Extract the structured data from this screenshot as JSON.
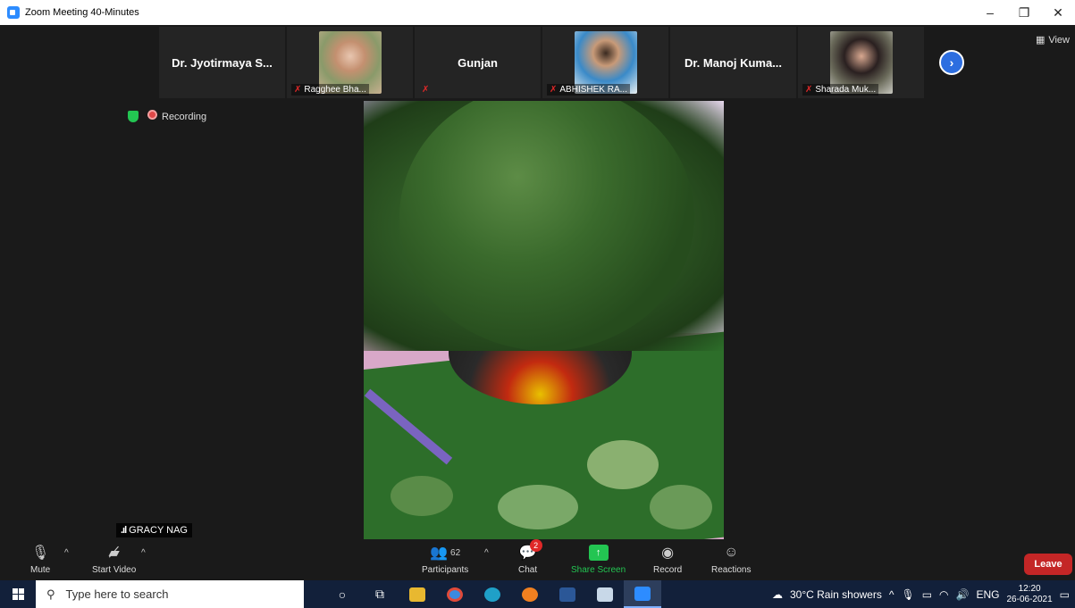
{
  "window": {
    "title": "Zoom Meeting 40-Minutes",
    "controls": [
      "–",
      "❐",
      "✕"
    ]
  },
  "thumbnails": [
    {
      "name": "Dr. Jyotirmaya S...",
      "has_video": false
    },
    {
      "name": "Ragghee Bha...",
      "has_video": true,
      "muted": true
    },
    {
      "name": "Gunjan",
      "has_video": false,
      "muted": true
    },
    {
      "name": "ABHISHEK RA...",
      "has_video": true,
      "muted": true
    },
    {
      "name": "Dr. Manoj Kuma...",
      "has_video": false
    },
    {
      "name": "Sharada Muk...",
      "has_video": true,
      "muted": true
    }
  ],
  "view_label": "View",
  "recording_label": "Recording",
  "main_video": {
    "name": "GRACY NAG"
  },
  "toolbar": {
    "mute": "Mute",
    "start_video": "Start Video",
    "participants": "Participants",
    "participants_count": "62",
    "chat": "Chat",
    "chat_badge": "2",
    "share_screen": "Share Screen",
    "record": "Record",
    "reactions": "Reactions",
    "leave": "Leave"
  },
  "taskbar": {
    "search_placeholder": "Type here to search",
    "weather": "30°C  Rain showers",
    "language": "ENG",
    "time": "12:20",
    "date": "26-06-2021"
  },
  "colors": {
    "accent": "#2d8cff",
    "share": "#23c552",
    "leave": "#c42626",
    "taskbar": "#12203a"
  }
}
